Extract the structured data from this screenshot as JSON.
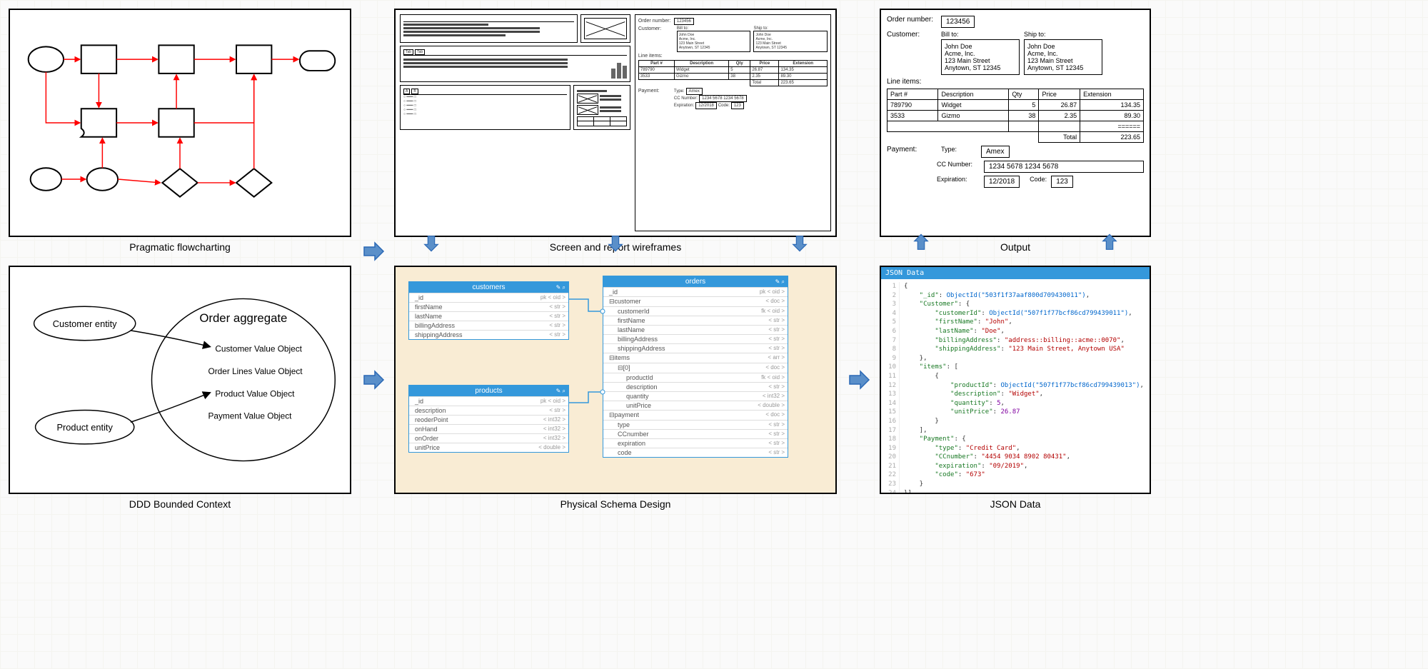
{
  "captions": {
    "flowchart": "Pragmatic flowcharting",
    "wireframes": "Screen and report wireframes",
    "output": "Output",
    "ddd": "DDD Bounded Context",
    "schema": "Physical Schema Design",
    "json": "JSON Data"
  },
  "output": {
    "order_label": "Order number:",
    "order_value": "123456",
    "customer_label": "Customer:",
    "billto_label": "Bill to:",
    "shipto_label": "Ship to:",
    "bill_addr": [
      "John Doe",
      "Acme, Inc.",
      "123 Main Street",
      "Anytown, ST 12345"
    ],
    "ship_addr": [
      "John Doe",
      "Acme, Inc.",
      "123 Main Street",
      "Anytown, ST 12345"
    ],
    "lineitems_label": "Line items:",
    "table": {
      "headers": [
        "Part #",
        "Description",
        "Qty",
        "Price",
        "Extension"
      ],
      "rows": [
        [
          "789790",
          "Widget",
          "5",
          "26.87",
          "134.35"
        ],
        [
          "3533",
          "Gizmo",
          "38",
          "2.35",
          "89.30"
        ]
      ],
      "total_label": "Total",
      "total_value": "223.65"
    },
    "payment_label": "Payment:",
    "type_label": "Type:",
    "type_value": "Amex",
    "cc_label": "CC Number:",
    "cc_value": "1234 5678 1234 5678",
    "exp_label": "Expiration:",
    "exp_value": "12/2018",
    "code_label": "Code:",
    "code_value": "123"
  },
  "wireframe_order": {
    "order_label": "Order number:",
    "order_value": "123456",
    "customer_label": "Customer:",
    "billto_label": "Bill to:",
    "shipto_label": "Ship to:",
    "addr": [
      "John Doe",
      "Acme, Inc.",
      "123 Main Street",
      "Anytown, ST 12345"
    ],
    "lineitems_label": "Line items:",
    "headers": [
      "Part #",
      "Description",
      "Qty",
      "Price",
      "Extension"
    ],
    "row1": [
      "789790",
      "Widget",
      "5",
      "26.87",
      "134.35"
    ],
    "row2": [
      "3533",
      "Gizmo",
      "38",
      "2.35",
      "89.30"
    ],
    "total_label": "Total",
    "total_value": "223.65",
    "payment_label": "Payment:",
    "type_label": "Type:",
    "type_value": "Amex",
    "cc_label": "CC Number:",
    "cc_value": "1234 5678 1234 5678",
    "exp_label": "Expiration:",
    "exp_value": "12/2018",
    "code_label": "Code:",
    "code_value": "123"
  },
  "ddd": {
    "customer": "Customer entity",
    "product": "Product entity",
    "aggregate": "Order aggregate",
    "cust_vo": "Customer Value Object",
    "lines_vo": "Order Lines Value Object",
    "prod_vo": "Product Value Object",
    "pay_vo": "Payment Value Object"
  },
  "schema": {
    "customers": {
      "title": "customers",
      "fields": [
        {
          "name": "_id",
          "meta": "pk     < oid >"
        },
        {
          "name": "firstName",
          "meta": "< str >"
        },
        {
          "name": "lastName",
          "meta": "< str >"
        },
        {
          "name": "billingAddress",
          "meta": "< str >"
        },
        {
          "name": "shippingAddress",
          "meta": "< str >"
        }
      ]
    },
    "products": {
      "title": "products",
      "fields": [
        {
          "name": "_id",
          "meta": "pk     < oid >"
        },
        {
          "name": "description",
          "meta": "< str >"
        },
        {
          "name": "reoderPoint",
          "meta": "< int32 >"
        },
        {
          "name": "onHand",
          "meta": "< int32 >"
        },
        {
          "name": "onOrder",
          "meta": "< int32 >"
        },
        {
          "name": "unitPrice",
          "meta": "< double >"
        }
      ]
    },
    "orders": {
      "title": "orders",
      "fields": [
        {
          "name": "_id",
          "meta": "pk     < oid >",
          "indent": 0
        },
        {
          "name": "⊟customer",
          "meta": "< doc >",
          "indent": 0
        },
        {
          "name": "customerId",
          "meta": "fk     < oid >",
          "indent": 1
        },
        {
          "name": "firstName",
          "meta": "< str >",
          "indent": 1
        },
        {
          "name": "lastName",
          "meta": "< str >",
          "indent": 1
        },
        {
          "name": "billingAddress",
          "meta": "< str >",
          "indent": 1
        },
        {
          "name": "shippingAddress",
          "meta": "< str >",
          "indent": 1
        },
        {
          "name": "⊟items",
          "meta": "< arr >",
          "indent": 0
        },
        {
          "name": "⊟[0]",
          "meta": "< doc >",
          "indent": 1
        },
        {
          "name": "productId",
          "meta": "fk     < oid >",
          "indent": 2
        },
        {
          "name": "description",
          "meta": "< str >",
          "indent": 2
        },
        {
          "name": "quantity",
          "meta": "< int32 >",
          "indent": 2
        },
        {
          "name": "unitPrice",
          "meta": "< double >",
          "indent": 2
        },
        {
          "name": "⊟payment",
          "meta": "< doc >",
          "indent": 0
        },
        {
          "name": "type",
          "meta": "< str >",
          "indent": 1
        },
        {
          "name": "CCnumber",
          "meta": "< str >",
          "indent": 1
        },
        {
          "name": "expiration",
          "meta": "< str >",
          "indent": 1
        },
        {
          "name": "code",
          "meta": "< str >",
          "indent": 1
        }
      ]
    }
  },
  "json_view": {
    "title": "JSON Data",
    "lines": [
      [
        {
          "t": "{",
          "c": "punct"
        }
      ],
      [
        {
          "t": "    \"_id\"",
          "c": "key"
        },
        {
          "t": ": ",
          "c": "punct"
        },
        {
          "t": "ObjectId(\"503f1f37aaf800d709430011\")",
          "c": "func"
        },
        {
          "t": ",",
          "c": "punct"
        }
      ],
      [
        {
          "t": "    \"Customer\"",
          "c": "key"
        },
        {
          "t": ": {",
          "c": "punct"
        }
      ],
      [
        {
          "t": "        \"customerId\"",
          "c": "key"
        },
        {
          "t": ": ",
          "c": "punct"
        },
        {
          "t": "ObjectId(\"507f1f77bcf86cd799439011\")",
          "c": "func"
        },
        {
          "t": ",",
          "c": "punct"
        }
      ],
      [
        {
          "t": "        \"firstName\"",
          "c": "key"
        },
        {
          "t": ": ",
          "c": "punct"
        },
        {
          "t": "\"John\"",
          "c": "str"
        },
        {
          "t": ",",
          "c": "punct"
        }
      ],
      [
        {
          "t": "        \"lastName\"",
          "c": "key"
        },
        {
          "t": ": ",
          "c": "punct"
        },
        {
          "t": "\"Doe\"",
          "c": "str"
        },
        {
          "t": ",",
          "c": "punct"
        }
      ],
      [
        {
          "t": "        \"billingAddress\"",
          "c": "key"
        },
        {
          "t": ": ",
          "c": "punct"
        },
        {
          "t": "\"address::billing::acme::0070\"",
          "c": "str"
        },
        {
          "t": ",",
          "c": "punct"
        }
      ],
      [
        {
          "t": "        \"shippingAddress\"",
          "c": "key"
        },
        {
          "t": ": ",
          "c": "punct"
        },
        {
          "t": "\"123 Main Street, Anytown USA\"",
          "c": "str"
        }
      ],
      [
        {
          "t": "    },",
          "c": "punct"
        }
      ],
      [
        {
          "t": "    \"items\"",
          "c": "key"
        },
        {
          "t": ": [",
          "c": "punct"
        }
      ],
      [
        {
          "t": "        {",
          "c": "punct"
        }
      ],
      [
        {
          "t": "            \"productId\"",
          "c": "key"
        },
        {
          "t": ": ",
          "c": "punct"
        },
        {
          "t": "ObjectId(\"507f1f77bcf86cd799439013\")",
          "c": "func"
        },
        {
          "t": ",",
          "c": "punct"
        }
      ],
      [
        {
          "t": "            \"description\"",
          "c": "key"
        },
        {
          "t": ": ",
          "c": "punct"
        },
        {
          "t": "\"Widget\"",
          "c": "str"
        },
        {
          "t": ",",
          "c": "punct"
        }
      ],
      [
        {
          "t": "            \"quantity\"",
          "c": "key"
        },
        {
          "t": ": ",
          "c": "punct"
        },
        {
          "t": "5",
          "c": "num"
        },
        {
          "t": ",",
          "c": "punct"
        }
      ],
      [
        {
          "t": "            \"unitPrice\"",
          "c": "key"
        },
        {
          "t": ": ",
          "c": "punct"
        },
        {
          "t": "26.87",
          "c": "num"
        }
      ],
      [
        {
          "t": "        }",
          "c": "punct"
        }
      ],
      [
        {
          "t": "    ],",
          "c": "punct"
        }
      ],
      [
        {
          "t": "    \"Payment\"",
          "c": "key"
        },
        {
          "t": ": {",
          "c": "punct"
        }
      ],
      [
        {
          "t": "        \"type\"",
          "c": "key"
        },
        {
          "t": ": ",
          "c": "punct"
        },
        {
          "t": "\"Credit Card\"",
          "c": "str"
        },
        {
          "t": ",",
          "c": "punct"
        }
      ],
      [
        {
          "t": "        \"CCnumber\"",
          "c": "key"
        },
        {
          "t": ": ",
          "c": "punct"
        },
        {
          "t": "\"4454 9034 8902 80431\"",
          "c": "str"
        },
        {
          "t": ",",
          "c": "punct"
        }
      ],
      [
        {
          "t": "        \"expiration\"",
          "c": "key"
        },
        {
          "t": ": ",
          "c": "punct"
        },
        {
          "t": "\"09/2019\"",
          "c": "str"
        },
        {
          "t": ",",
          "c": "punct"
        }
      ],
      [
        {
          "t": "        \"code\"",
          "c": "key"
        },
        {
          "t": ": ",
          "c": "punct"
        },
        {
          "t": "\"673\"",
          "c": "str"
        }
      ],
      [
        {
          "t": "    }",
          "c": "punct"
        }
      ],
      [
        {
          "t": "}]",
          "c": "punct"
        }
      ]
    ]
  }
}
